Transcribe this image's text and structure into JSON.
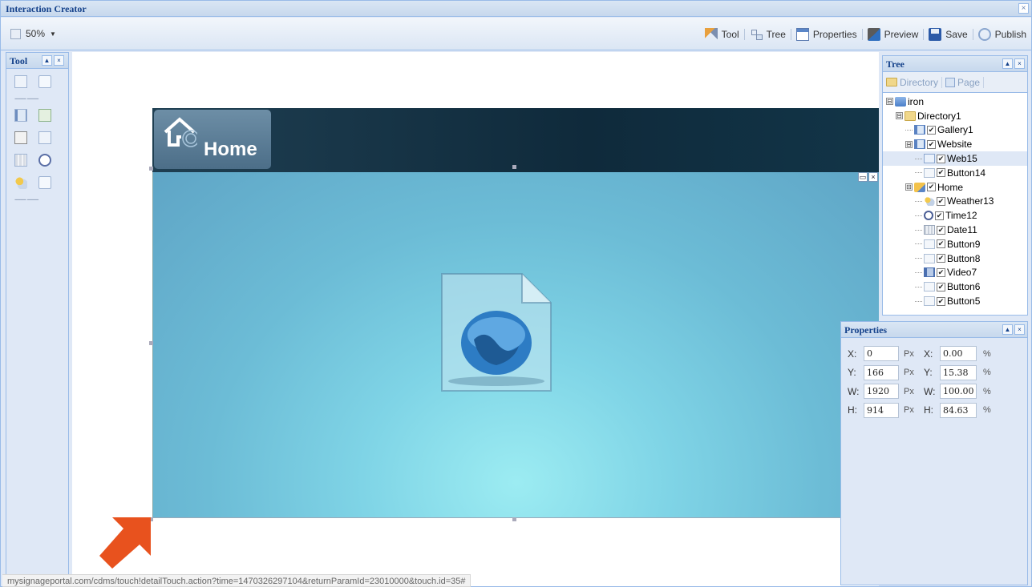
{
  "window": {
    "title": "Interaction Creator",
    "close_glyph": "×"
  },
  "toolbar": {
    "zoom": "50%",
    "buttons": [
      {
        "label": "Tool",
        "icon": "tool-icon"
      },
      {
        "label": "Tree",
        "icon": "tree-icon"
      },
      {
        "label": "Properties",
        "icon": "properties-icon"
      },
      {
        "label": "Preview",
        "icon": "preview-icon"
      },
      {
        "label": "Save",
        "icon": "save-icon"
      },
      {
        "label": "Publish",
        "icon": "publish-icon"
      }
    ]
  },
  "tool_panel": {
    "title": "Tool",
    "separator": "------- -------",
    "tools": [
      "select-area",
      "button",
      "gallery",
      "image",
      "text",
      "text-effect",
      "date",
      "clock",
      "weather",
      "web-page"
    ]
  },
  "canvas": {
    "logo_text": "Home",
    "web_controls": [
      "▭",
      "×"
    ],
    "colors": {
      "header": "#0f2a3b",
      "web_area": "#7fd4e6",
      "arrow": "#e8521e"
    }
  },
  "status_url": "mysignageportal.com/cdms/touch!detailTouch.action?time=1470326297104&returnParamId=23010000&touch.id=35#",
  "tree": {
    "title": "Tree",
    "tabs": [
      "Directory",
      "Page"
    ],
    "nodes": [
      {
        "label": "iron",
        "icon": "iron",
        "indent": 0,
        "expander": "⊟",
        "checked": null
      },
      {
        "label": "Directory1",
        "icon": "folder",
        "indent": 1,
        "expander": "⊟",
        "checked": null
      },
      {
        "label": "Gallery1",
        "icon": "gallery",
        "indent": 2,
        "expander": "",
        "checked": true
      },
      {
        "label": "Website",
        "icon": "gallery",
        "indent": 2,
        "expander": "⊟",
        "checked": true
      },
      {
        "label": "Web15",
        "icon": "page",
        "indent": 3,
        "expander": "",
        "checked": true,
        "selected": true
      },
      {
        "label": "Button14",
        "icon": "btn",
        "indent": 3,
        "expander": "",
        "checked": true
      },
      {
        "label": "Home",
        "icon": "home",
        "indent": 2,
        "expander": "⊟",
        "checked": true
      },
      {
        "label": "Weather13",
        "icon": "weather",
        "indent": 3,
        "expander": "",
        "checked": true
      },
      {
        "label": "Time12",
        "icon": "clock",
        "indent": 3,
        "expander": "",
        "checked": true
      },
      {
        "label": "Date11",
        "icon": "date",
        "indent": 3,
        "expander": "",
        "checked": true
      },
      {
        "label": "Button9",
        "icon": "btn",
        "indent": 3,
        "expander": "",
        "checked": true
      },
      {
        "label": "Button8",
        "icon": "btn",
        "indent": 3,
        "expander": "",
        "checked": true
      },
      {
        "label": "Video7",
        "icon": "video",
        "indent": 3,
        "expander": "",
        "checked": true
      },
      {
        "label": "Button6",
        "icon": "btn",
        "indent": 3,
        "expander": "",
        "checked": true
      },
      {
        "label": "Button5",
        "icon": "btn",
        "indent": 3,
        "expander": "",
        "checked": true
      }
    ]
  },
  "properties": {
    "title": "Properties",
    "rows": [
      {
        "label": "X:",
        "px": "0",
        "px_unit": "Px",
        "pct_label": "X:",
        "pct": "0.00",
        "pct_unit": "%"
      },
      {
        "label": "Y:",
        "px": "166",
        "px_unit": "Px",
        "pct_label": "Y:",
        "pct": "15.38",
        "pct_unit": "%"
      },
      {
        "label": "W:",
        "px": "1920",
        "px_unit": "Px",
        "pct_label": "W:",
        "pct": "100.00",
        "pct_unit": "%"
      },
      {
        "label": "H:",
        "px": "914",
        "px_unit": "Px",
        "pct_label": "H:",
        "pct": "84.63",
        "pct_unit": "%"
      }
    ]
  },
  "panel_buttons": {
    "collapse": "▲",
    "close": "×"
  }
}
